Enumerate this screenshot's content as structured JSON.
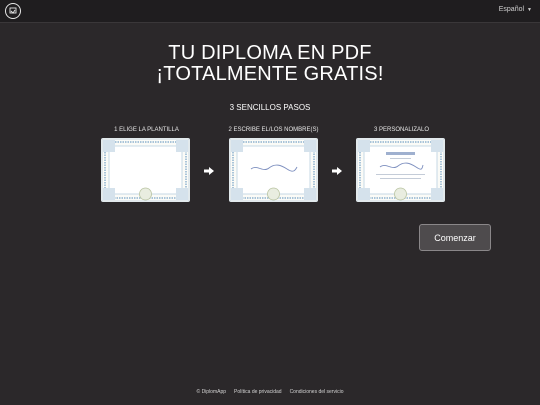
{
  "header": {
    "logo_icon": "diplomapp-logo-icon",
    "language": "Español",
    "language_icon": "chevron-down-icon"
  },
  "hero": {
    "line1": "TU DIPLOMA EN PDF",
    "line2": "¡TOTALMENTE GRATIS!"
  },
  "steps": {
    "title": "3 SENCILLOS PASOS",
    "items": [
      {
        "label": "1 ELIGE LA PLANTILLA"
      },
      {
        "label": "2 ESCRIBE EL/LOS NOMBRE(S)"
      },
      {
        "label": "3 PERSONALIZALO"
      }
    ]
  },
  "cta": {
    "label": "Comenzar"
  },
  "footer": {
    "copyright": "© DiplomApp",
    "privacy": "Política de privacidad",
    "terms": "Condiciones del servicio"
  },
  "colors": {
    "background": "#2b282a",
    "topbar": "#1f1d1f",
    "button": "#4e4b4d",
    "certificate_border": "#a9c4d9"
  }
}
